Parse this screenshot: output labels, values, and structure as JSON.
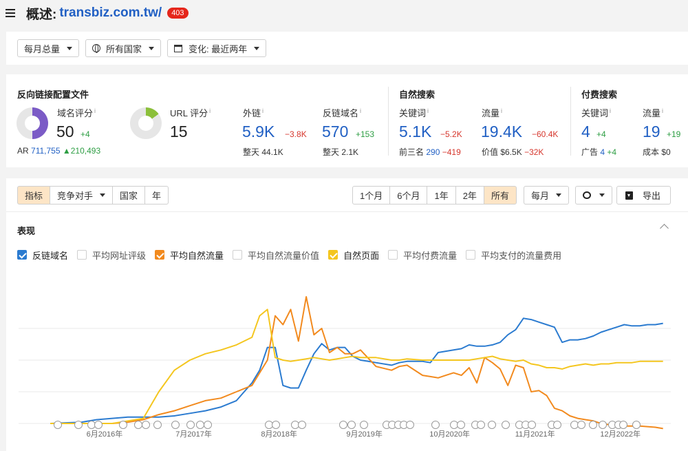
{
  "header": {
    "title_prefix": "概述:",
    "domain": "transbiz.com.tw/",
    "badge": "403"
  },
  "filters": {
    "monthly": "每月总量",
    "country": "所有国家",
    "change": "变化: 最近两年"
  },
  "backlinks": {
    "section_title": "反向链接配置文件",
    "dr_label": "域名评分",
    "dr_value": "50",
    "dr_delta": "+4",
    "ar_label": "AR",
    "ar_value": "711,755",
    "ar_delta": "▲210,493",
    "ur_label": "URL 评分",
    "ur_value": "15",
    "links_label": "外链",
    "links_value": "5.9K",
    "links_delta": "−3.8K",
    "links_sub_label": "整天",
    "links_sub_value": "44.1K",
    "rd_label": "反链域名",
    "rd_value": "570",
    "rd_delta": "+153",
    "rd_sub_label": "整天",
    "rd_sub_value": "2.1K"
  },
  "organic": {
    "section_title": "自然搜索",
    "kw_label": "关键词",
    "kw_value": "5.1K",
    "kw_delta": "−5.2K",
    "kw_sub_label": "前三名",
    "kw_sub_value": "290",
    "kw_sub_delta": "−419",
    "traffic_label": "流量",
    "traffic_value": "19.4K",
    "traffic_delta": "−60.4K",
    "traffic_sub_label": "价值",
    "traffic_sub_value": "$6.5K",
    "traffic_sub_delta": "−32K"
  },
  "paid": {
    "section_title": "付费搜索",
    "kw_label": "关键词",
    "kw_value": "4",
    "kw_delta": "+4",
    "kw_sub_label": "广告",
    "kw_sub_value": "4",
    "kw_sub_delta": "+4",
    "traffic_label": "流量",
    "traffic_value": "19",
    "traffic_delta": "+19",
    "traffic_sub_label": "成本",
    "traffic_sub_value": "$0"
  },
  "tabs": {
    "metrics": "指标",
    "competitors": "竞争对手",
    "country": "国家",
    "year": "年"
  },
  "ranges": [
    "1个月",
    "6个月",
    "1年",
    "2年",
    "所有"
  ],
  "interval": "每月",
  "export": "导出",
  "performance_title": "表现",
  "legend": [
    {
      "label": "反链域名",
      "checked": true,
      "color": "#2b7bd0"
    },
    {
      "label": "平均网址评级",
      "checked": false,
      "color": ""
    },
    {
      "label": "平均自然流量",
      "checked": true,
      "color": "#f28a1e"
    },
    {
      "label": "平均自然流量价值",
      "checked": false,
      "color": ""
    },
    {
      "label": "自然页面",
      "checked": true,
      "color": "#f4c61f"
    },
    {
      "label": "平均付费流量",
      "checked": false,
      "color": ""
    },
    {
      "label": "平均支付的流量费用",
      "checked": false,
      "color": ""
    }
  ],
  "icons": {
    "menu": "hamburger-icon",
    "globe": "globe-icon",
    "calendar": "calendar-icon",
    "comment": "comment-icon",
    "export": "download-icon",
    "collapse": "chevron-up-icon"
  },
  "colors": {
    "domain": "#2160c4",
    "badge": "#e5261b",
    "dr_donut": "#7b5bc6",
    "ur_donut": "#8bbf3a",
    "positive": "#2e9e44",
    "negative": "#d6362c",
    "active_tab": "#fde5c6"
  },
  "chart_data": {
    "type": "line",
    "x_labels": [
      "6月2016年",
      "7月2017年",
      "8月2018年",
      "9月2019年",
      "10月2020年",
      "11月2021年",
      "12月2022年"
    ],
    "x_domain": [
      0,
      80
    ],
    "label_positions": [
      7,
      18.5,
      29.5,
      40.5,
      51.5,
      62.5,
      73.5
    ],
    "y_domain": [
      0,
      100
    ],
    "grid": true,
    "series": [
      {
        "name": "反链域名",
        "color": "#2b7bd0",
        "x": [
          0,
          4,
          6,
          8,
          10,
          12,
          14,
          16,
          18,
          20,
          22,
          24,
          26,
          27,
          28,
          29,
          30,
          31,
          32,
          33,
          34,
          35,
          36,
          37,
          38,
          39,
          40,
          41,
          42,
          44,
          45,
          46,
          48,
          49,
          50,
          51,
          52,
          53,
          54,
          55,
          56,
          57,
          58,
          59,
          60,
          61,
          62,
          63,
          64,
          65,
          66,
          67,
          68,
          69,
          70,
          71,
          72,
          73,
          74,
          75,
          76,
          77,
          78,
          79
        ],
        "y": [
          0,
          1,
          3,
          4,
          5,
          5,
          5,
          6,
          8,
          10,
          13,
          18,
          32,
          42,
          60,
          60,
          30,
          28,
          28,
          42,
          55,
          63,
          58,
          60,
          60,
          53,
          50,
          49,
          48,
          46,
          48,
          49,
          49,
          48,
          56,
          57,
          58,
          59,
          62,
          61,
          61,
          62,
          64,
          70,
          74,
          83,
          82,
          80,
          78,
          76,
          64,
          66,
          66,
          67,
          69,
          72,
          74,
          76,
          78,
          77,
          77,
          78,
          78,
          79
        ]
      },
      {
        "name": "平均自然流量",
        "color": "#f28a1e",
        "x": [
          0,
          8,
          10,
          12,
          14,
          16,
          18,
          20,
          22,
          24,
          26,
          28,
          29,
          30,
          31,
          32,
          33,
          34,
          35,
          36,
          37,
          38,
          39,
          40,
          42,
          44,
          45,
          46,
          48,
          49,
          50,
          51,
          52,
          53,
          54,
          55,
          56,
          57,
          58,
          59,
          60,
          61,
          62,
          63,
          64,
          65,
          66,
          67,
          68,
          69,
          70,
          71,
          72,
          74,
          76,
          78,
          79
        ],
        "y": [
          0,
          0,
          1,
          3,
          7,
          10,
          14,
          18,
          20,
          25,
          30,
          50,
          85,
          78,
          90,
          65,
          100,
          70,
          75,
          56,
          60,
          55,
          55,
          58,
          45,
          42,
          45,
          46,
          38,
          37,
          36,
          38,
          40,
          38,
          44,
          32,
          52,
          48,
          43,
          30,
          46,
          44,
          25,
          26,
          22,
          12,
          10,
          6,
          4,
          3,
          2,
          0,
          -1,
          -2,
          -2,
          -3,
          -4
        ]
      },
      {
        "name": "自然页面",
        "color": "#f4c61f",
        "x": [
          0,
          8,
          10,
          12,
          14,
          16,
          18,
          20,
          22,
          24,
          26,
          27,
          28,
          29,
          30,
          31,
          32,
          33,
          34,
          35,
          36,
          37,
          38,
          39,
          40,
          42,
          44,
          45,
          46,
          48,
          50,
          52,
          54,
          56,
          57,
          58,
          59,
          60,
          61,
          62,
          63,
          64,
          65,
          66,
          67,
          68,
          69,
          70,
          71,
          72,
          73,
          74,
          75,
          76,
          77,
          78,
          79
        ],
        "y": [
          0,
          0,
          2,
          4,
          25,
          42,
          50,
          55,
          58,
          62,
          68,
          85,
          90,
          52,
          50,
          49,
          50,
          51,
          52,
          51,
          50,
          51,
          52,
          53,
          52,
          52,
          50,
          50,
          51,
          50,
          50,
          50,
          50,
          52,
          53,
          51,
          50,
          49,
          50,
          47,
          46,
          44,
          44,
          43,
          45,
          46,
          47,
          46,
          47,
          47,
          48,
          48,
          48,
          49,
          49,
          49,
          49
        ]
      }
    ]
  }
}
